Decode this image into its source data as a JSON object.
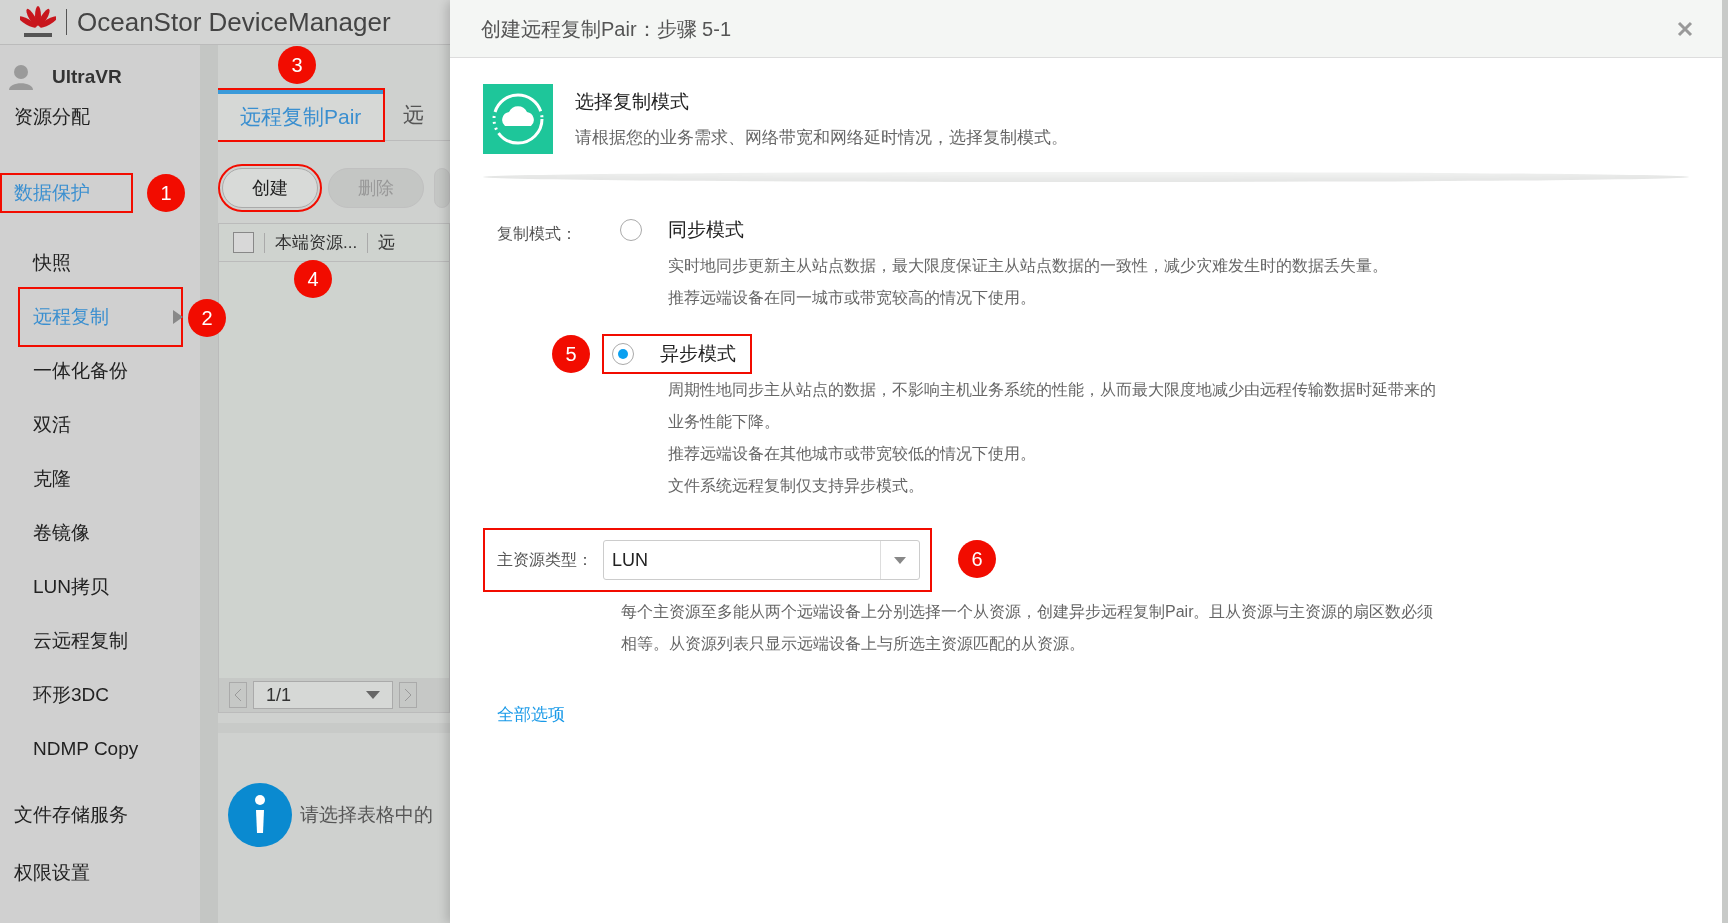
{
  "app": {
    "title": "OceanStor DeviceManager",
    "user": "UltraVR"
  },
  "sidebar": {
    "items": [
      {
        "label": "资源分配",
        "selected": false
      },
      {
        "label": "数据保护",
        "selected": true,
        "callout": "1",
        "children": [
          {
            "label": "快照",
            "selected": false
          },
          {
            "label": "远程复制",
            "selected": true,
            "callout": "2",
            "has_submenu": true
          },
          {
            "label": "一体化备份",
            "selected": false
          },
          {
            "label": "双活",
            "selected": false
          },
          {
            "label": "克隆",
            "selected": false
          },
          {
            "label": "卷镜像",
            "selected": false
          },
          {
            "label": "LUN拷贝",
            "selected": false
          },
          {
            "label": "云远程复制",
            "selected": false
          },
          {
            "label": "环形3DC",
            "selected": false
          },
          {
            "label": "NDMP Copy",
            "selected": false
          }
        ]
      },
      {
        "label": "文件存储服务",
        "selected": false
      },
      {
        "label": "权限设置",
        "selected": false
      }
    ]
  },
  "tabs": [
    {
      "label": "远程复制Pair",
      "selected": true,
      "callout": "3"
    },
    {
      "label": "远",
      "selected": false
    }
  ],
  "toolbar": [
    {
      "label": "创建",
      "disabled": false,
      "callout": "4"
    },
    {
      "label": "删除",
      "disabled": true
    }
  ],
  "table": {
    "select_all": false,
    "columns": [
      "本端资源...",
      "远"
    ]
  },
  "pager": {
    "value": "1/1"
  },
  "info": {
    "text": "请选择表格中的"
  },
  "dialog": {
    "title": "创建远程复制Pair：步骤 5-1",
    "heading": "选择复制模式",
    "subheading": "请根据您的业务需求、网络带宽和网络延时情况，选择复制模式。",
    "mode_label": "复制模式：",
    "modes": [
      {
        "label": "同步模式",
        "selected": false,
        "description": [
          "实时地同步更新主从站点数据，最大限度保证主从站点数据的一致性，减少灾难发生时的数据丢失量。",
          "推荐远端设备在同一城市或带宽较高的情况下使用。"
        ]
      },
      {
        "label": "异步模式",
        "selected": true,
        "callout": "5",
        "description": [
          "周期性地同步主从站点的数据，不影响主机业务系统的性能，从而最大限度地减少由远程传输数据时延带来的",
          "业务性能下降。",
          "推荐远端设备在其他城市或带宽较低的情况下使用。",
          "文件系统远程复制仅支持异步模式。"
        ]
      }
    ],
    "resource_type": {
      "label": "主资源类型：",
      "value": "LUN",
      "callout": "6",
      "hint": [
        "每个主资源至多能从两个远端设备上分别选择一个从资源，创建异步远程复制Pair。且从资源与主资源的扇区数必须",
        "相等。从资源列表只显示远端设备上与所选主资源匹配的从资源。"
      ]
    },
    "link": "全部选项"
  }
}
